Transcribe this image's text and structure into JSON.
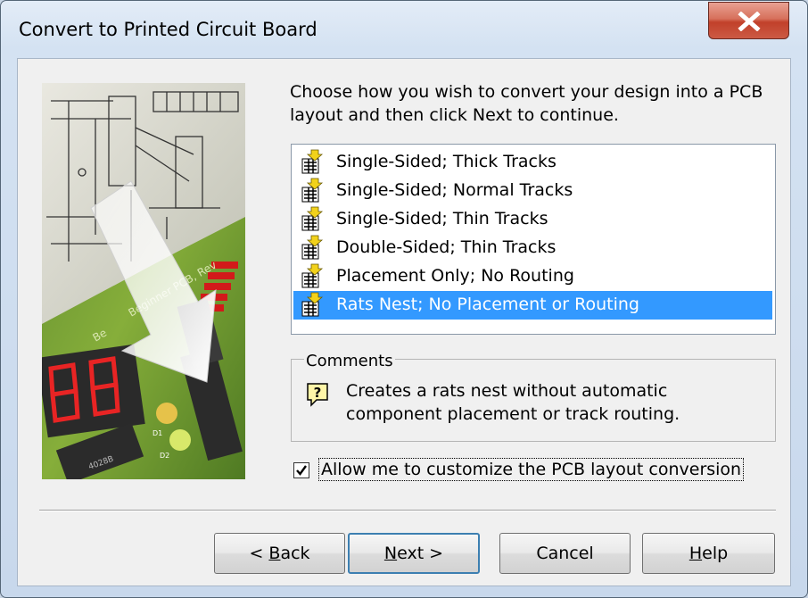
{
  "window": {
    "title": "Convert to Printed Circuit Board"
  },
  "prompt": "Choose how you wish to convert your design into a PCB layout and then click Next to continue.",
  "options": [
    {
      "label": "Single-Sided; Thick Tracks",
      "selected": false
    },
    {
      "label": "Single-Sided; Normal Tracks",
      "selected": false
    },
    {
      "label": "Single-Sided; Thin Tracks",
      "selected": false
    },
    {
      "label": "Double-Sided; Thin Tracks",
      "selected": false
    },
    {
      "label": "Placement Only; No Routing",
      "selected": false
    },
    {
      "label": "Rats Nest; No Placement or Routing",
      "selected": true
    }
  ],
  "option_icon": "pcb-convert-icon",
  "comments": {
    "title": "Comments",
    "icon": "help-question-icon",
    "line1": "Creates a rats nest without automatic",
    "line2": "component placement or track routing."
  },
  "customize": {
    "label": "Allow me to customize the PCB layout conversion",
    "checked": true
  },
  "buttons": {
    "back_prefix": "< ",
    "back_mnemonic": "B",
    "back_rest": "ack",
    "next_mnemonic": "N",
    "next_rest": "ext >",
    "cancel": "Cancel",
    "help_mnemonic": "H",
    "help_rest": "elp"
  },
  "illustration": {
    "board_text_1": "Beginner PCB, Rev",
    "board_text_2": "Be",
    "chip_label": "4028B",
    "led_labels": [
      "D1",
      "D2"
    ]
  },
  "colors": {
    "selection": "#3399ff",
    "close_button": "#c7452f",
    "default_button_border": "#3c7fb1"
  }
}
